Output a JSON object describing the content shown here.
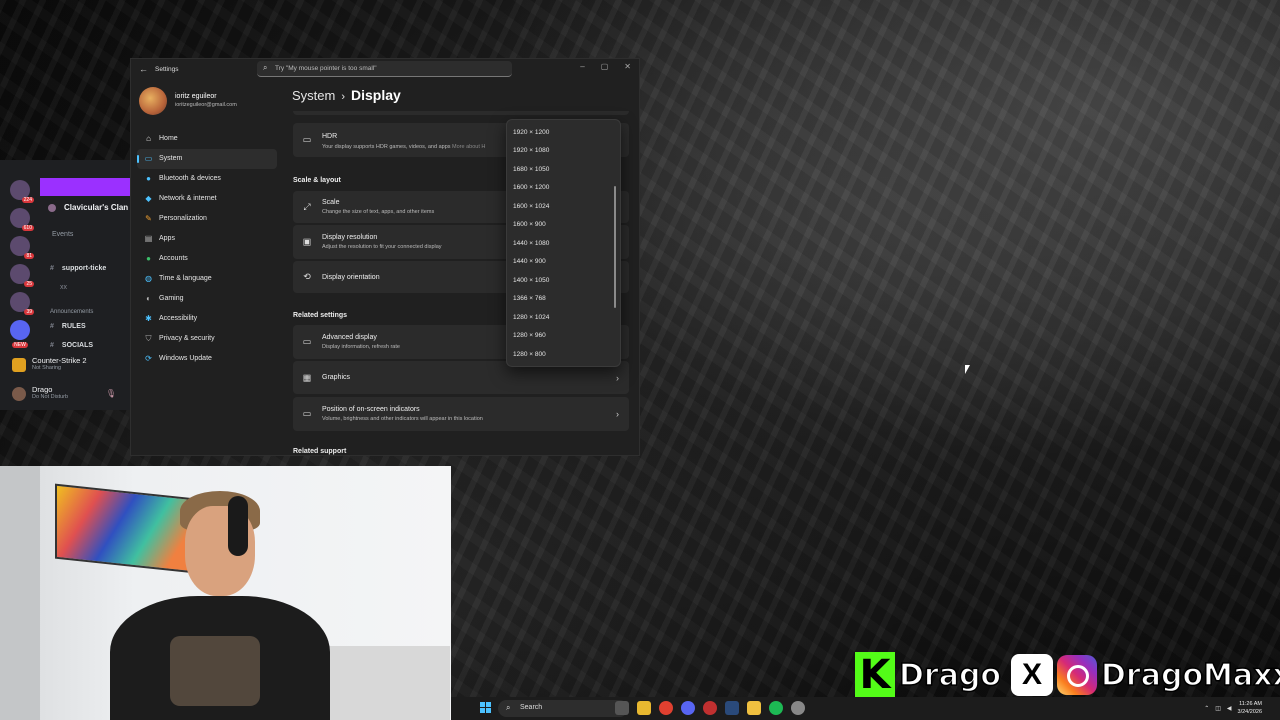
{
  "discord": {
    "clan_name": "Clavicular's Clan",
    "events_label": "Events",
    "channel_support": "support-ticke",
    "voice_channel": "xx",
    "announcements_label": "Announcements",
    "channel_rules": "RULES",
    "channel_socials": "SOCIALS",
    "server_badges": [
      "224",
      "610",
      "81",
      "25",
      "39"
    ],
    "new_badge": "NEW",
    "game_name": "Counter-Strike 2",
    "game_status": "Not Sharing",
    "user_name": "Drago",
    "user_status": "Do Not Disturb"
  },
  "settings": {
    "window_title": "Settings",
    "search_placeholder": "Try \"My mouse pointer is too small\"",
    "profile_name": "ioritz eguileor",
    "profile_email": "ioritzeguileor@gmail.com",
    "nav": [
      {
        "label": "Home",
        "icon": "home-icon"
      },
      {
        "label": "System",
        "icon": "system-icon"
      },
      {
        "label": "Bluetooth & devices",
        "icon": "bluetooth-icon"
      },
      {
        "label": "Network & internet",
        "icon": "network-icon"
      },
      {
        "label": "Personalization",
        "icon": "brush-icon"
      },
      {
        "label": "Apps",
        "icon": "apps-icon"
      },
      {
        "label": "Accounts",
        "icon": "accounts-icon"
      },
      {
        "label": "Time & language",
        "icon": "globe-icon"
      },
      {
        "label": "Gaming",
        "icon": "gamepad-icon"
      },
      {
        "label": "Accessibility",
        "icon": "accessibility-icon"
      },
      {
        "label": "Privacy & security",
        "icon": "shield-icon"
      },
      {
        "label": "Windows Update",
        "icon": "update-icon"
      }
    ],
    "breadcrumb_parent": "System",
    "breadcrumb_current": "Display",
    "hdr": {
      "title": "HDR",
      "desc": "Your display supports HDR games, videos, and apps",
      "more": "More about H"
    },
    "section_scale_layout": "Scale & layout",
    "scale": {
      "title": "Scale",
      "desc": "Change the size of text, apps, and other items"
    },
    "resolution": {
      "title": "Display resolution",
      "desc": "Adjust the resolution to fit your connected display"
    },
    "orientation": {
      "title": "Display orientation"
    },
    "section_related_settings": "Related settings",
    "advanced": {
      "title": "Advanced display",
      "desc": "Display information, refresh rate"
    },
    "graphics": {
      "title": "Graphics"
    },
    "osi": {
      "title": "Position of on-screen indicators",
      "desc": "Volume, brightness and other indicators will appear in this location"
    },
    "section_related_support": "Related support",
    "resolution_options": [
      "1920 × 1200",
      "1920 × 1080",
      "1680 × 1050",
      "1600 × 1200",
      "1600 × 1024",
      "1600 × 900",
      "1440 × 1080",
      "1440 × 900",
      "1400 × 1050",
      "1366 × 768",
      "1280 × 1024",
      "1280 × 960",
      "1280 × 800"
    ]
  },
  "streamer": {
    "kick_letter": "K",
    "kick_name": "Drago",
    "x_letter": "X",
    "ig_name": "DragoMaxxer"
  },
  "taskbar": {
    "search_label": "Search",
    "time": "11:26 AM",
    "date": "3/24/2026"
  },
  "colors": {
    "accent": "#4cc2ff",
    "kick": "#53fc18",
    "discord_banner": "#9b30ff"
  }
}
